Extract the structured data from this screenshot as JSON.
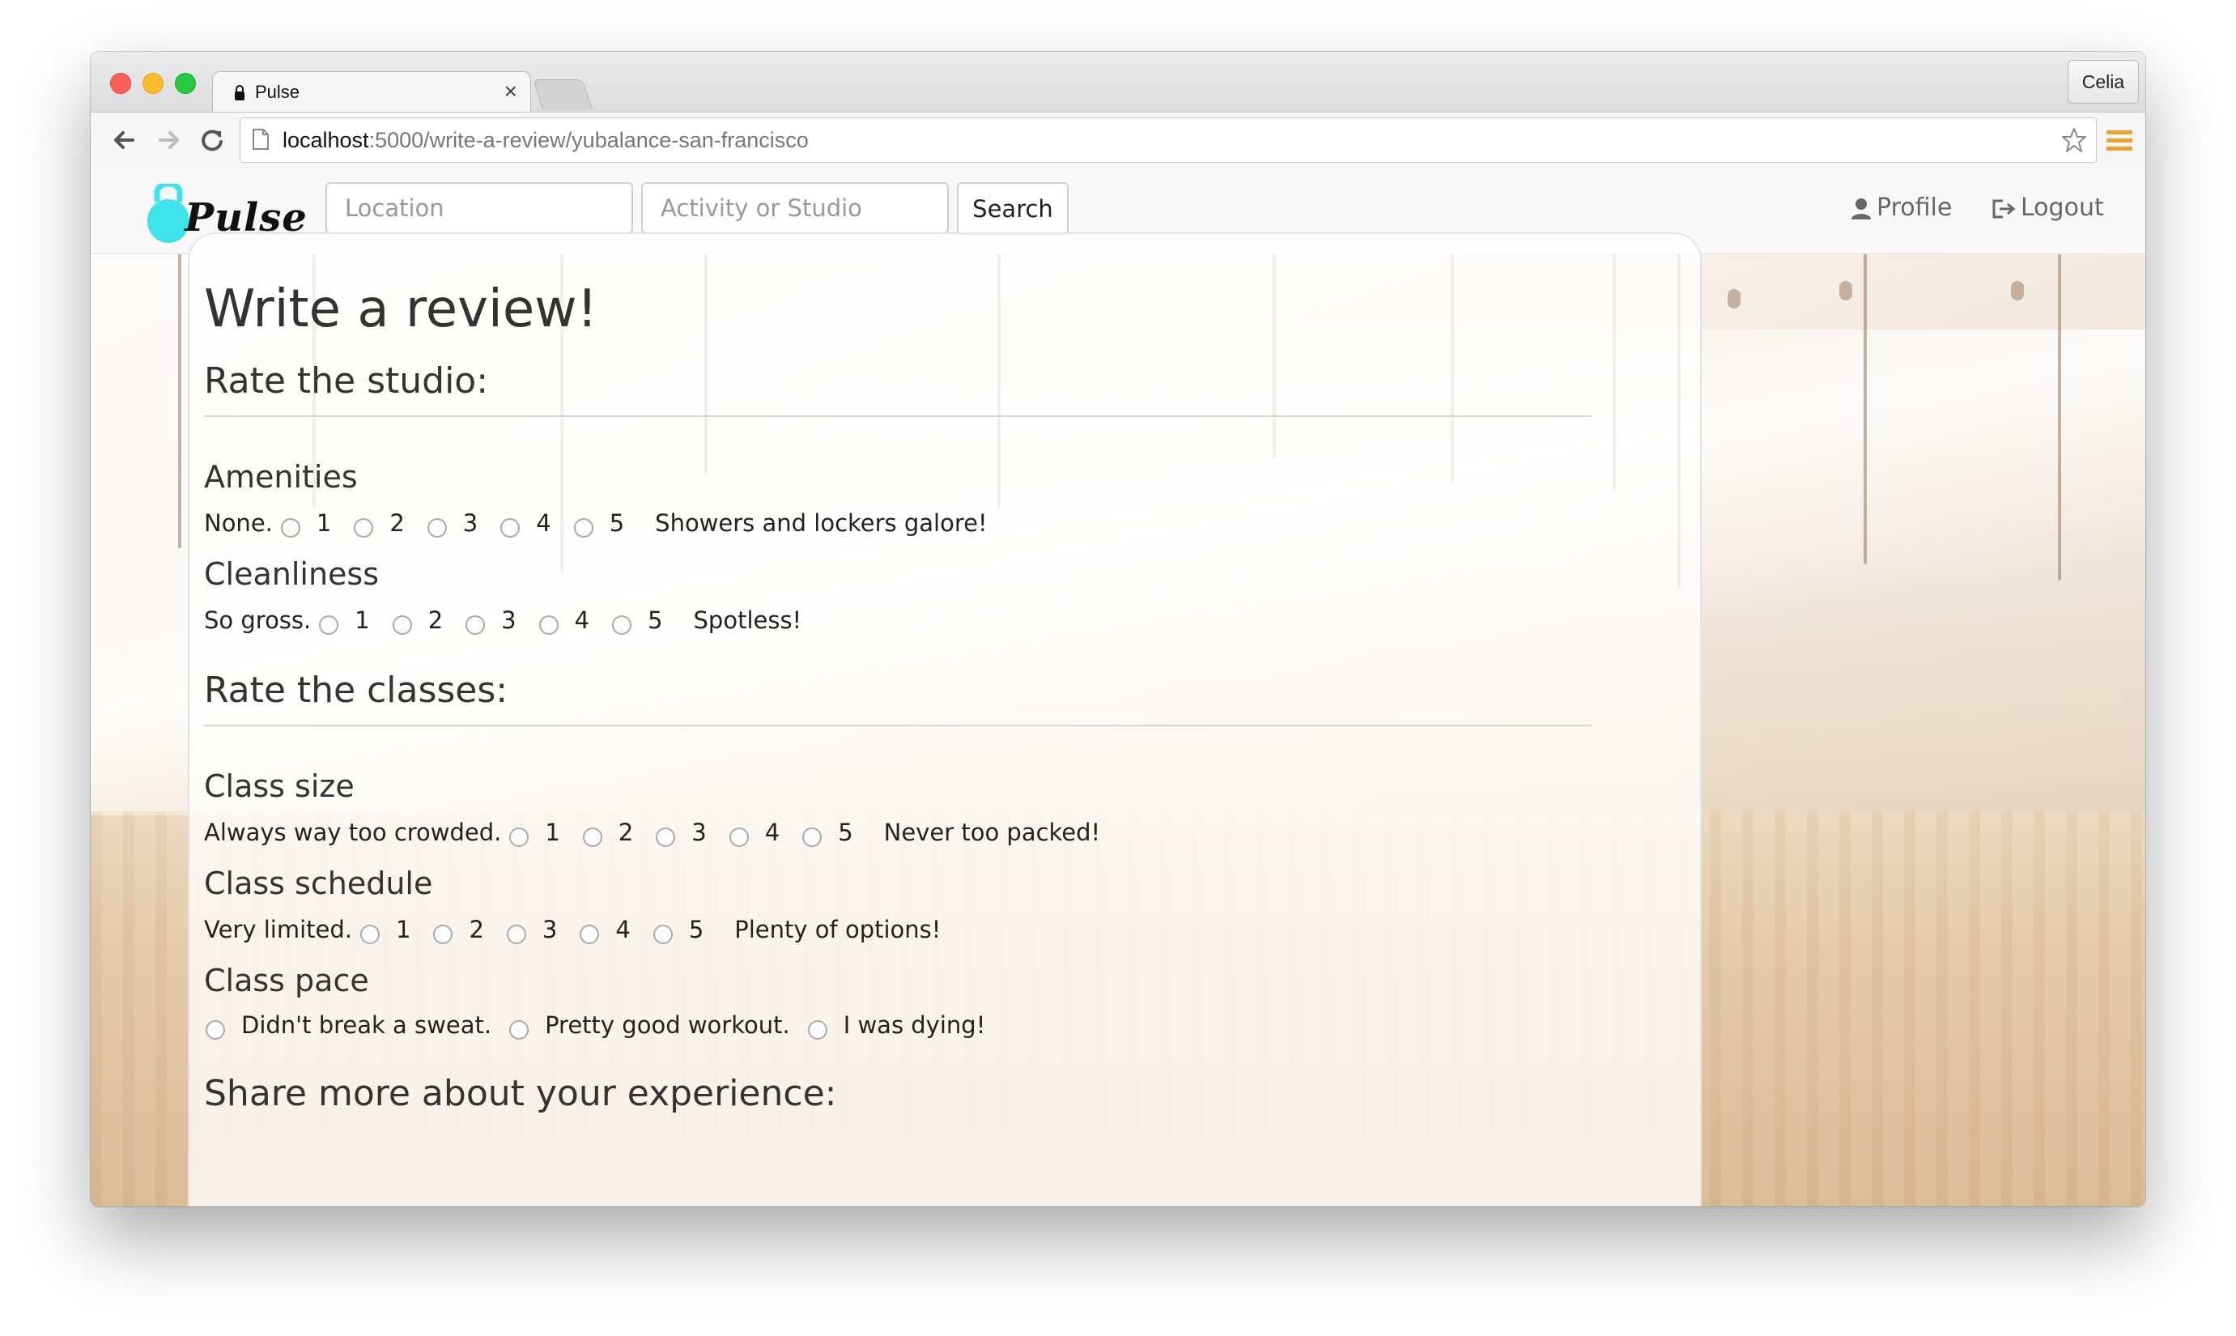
{
  "browser": {
    "tab_title": "Pulse",
    "tab_close": "×",
    "profile_name": "Celia",
    "url_host": "localhost",
    "url_rest": ":5000/write-a-review/yubalance-san-francisco"
  },
  "navbar": {
    "logo_text": "Pulse",
    "location_placeholder": "Location",
    "activity_placeholder": "Activity or Studio",
    "search_label": "Search",
    "profile_label": "Profile",
    "logout_label": "Logout"
  },
  "review": {
    "title": "Write a review!",
    "studio_heading": "Rate the studio:",
    "classes_heading": "Rate the classes:",
    "share_heading": "Share more about your experience:",
    "amenities": {
      "label": "Amenities",
      "low": "None.",
      "high": "Showers and lockers galore!",
      "options": [
        "1",
        "2",
        "3",
        "4",
        "5"
      ]
    },
    "cleanliness": {
      "label": "Cleanliness",
      "low": "So gross.",
      "high": "Spotless!",
      "options": [
        "1",
        "2",
        "3",
        "4",
        "5"
      ]
    },
    "class_size": {
      "label": "Class size",
      "low": "Always way too crowded.",
      "high": "Never too packed!",
      "options": [
        "1",
        "2",
        "3",
        "4",
        "5"
      ]
    },
    "class_schedule": {
      "label": "Class schedule",
      "low": "Very limited.",
      "high": "Plenty of options!",
      "options": [
        "1",
        "2",
        "3",
        "4",
        "5"
      ]
    },
    "class_pace": {
      "label": "Class pace",
      "options": [
        "Didn't break a sweat.",
        "Pretty good workout.",
        "I was dying!"
      ]
    }
  },
  "colors": {
    "logo_accent": "#3fe3ea",
    "menu_accent": "#f0a030"
  }
}
